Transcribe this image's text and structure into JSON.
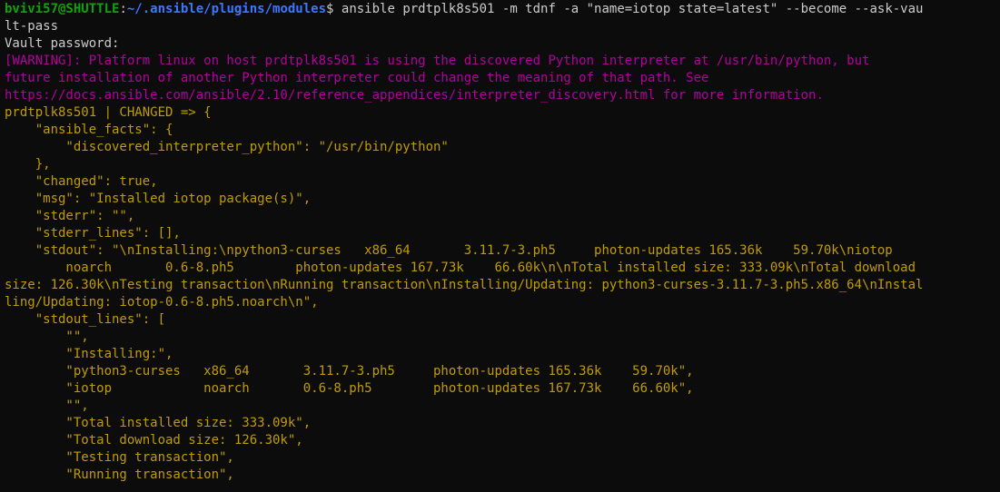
{
  "prompt": {
    "user_host": "bvivi57@SHUTTLE",
    "separator": ":",
    "path": "~/.ansible/plugins/modules",
    "symbol": "$ ",
    "command": "ansible prdtplk8s501 -m tdnf -a \"name=iotop state=latest\" --become --ask-vau",
    "command_wrap": "lt-pass"
  },
  "vault_prompt": "Vault password:",
  "warning_lines": [
    "[WARNING]: Platform linux on host prdtplk8s501 is using the discovered Python interpreter at /usr/bin/python, but",
    "future installation of another Python interpreter could change the meaning of that path. See",
    "https://docs.ansible.com/ansible/2.10/reference_appendices/interpreter_discovery.html for more information."
  ],
  "output_lines": [
    "prdtplk8s501 | CHANGED => {",
    "    \"ansible_facts\": {",
    "        \"discovered_interpreter_python\": \"/usr/bin/python\"",
    "    },",
    "    \"changed\": true,",
    "    \"msg\": \"Installed iotop package(s)\",",
    "    \"stderr\": \"\",",
    "    \"stderr_lines\": [],",
    "    \"stdout\": \"\\nInstalling:\\npython3-curses   x86_64       3.11.7-3.ph5     photon-updates 165.36k    59.70k\\niotop",
    "        noarch       0.6-8.ph5        photon-updates 167.73k    66.60k\\n\\nTotal installed size: 333.09k\\nTotal download",
    "size: 126.30k\\nTesting transaction\\nRunning transaction\\nInstalling/Updating: python3-curses-3.11.7-3.ph5.x86_64\\nInstal",
    "ling/Updating: iotop-0.6-8.ph5.noarch\\n\",",
    "    \"stdout_lines\": [",
    "        \"\",",
    "        \"Installing:\",",
    "        \"python3-curses   x86_64       3.11.7-3.ph5     photon-updates 165.36k    59.70k\",",
    "        \"iotop            noarch       0.6-8.ph5        photon-updates 167.73k    66.60k\",",
    "        \"\",",
    "        \"Total installed size: 333.09k\",",
    "        \"Total download size: 126.30k\",",
    "        \"Testing transaction\",",
    "        \"Running transaction\","
  ],
  "colors": {
    "background": "#0c0c0c",
    "foreground": "#cccccc",
    "prompt_user": "#13a10e",
    "prompt_path": "#3b78ff",
    "warning": "#b4009e",
    "changed_output": "#c19c00"
  }
}
